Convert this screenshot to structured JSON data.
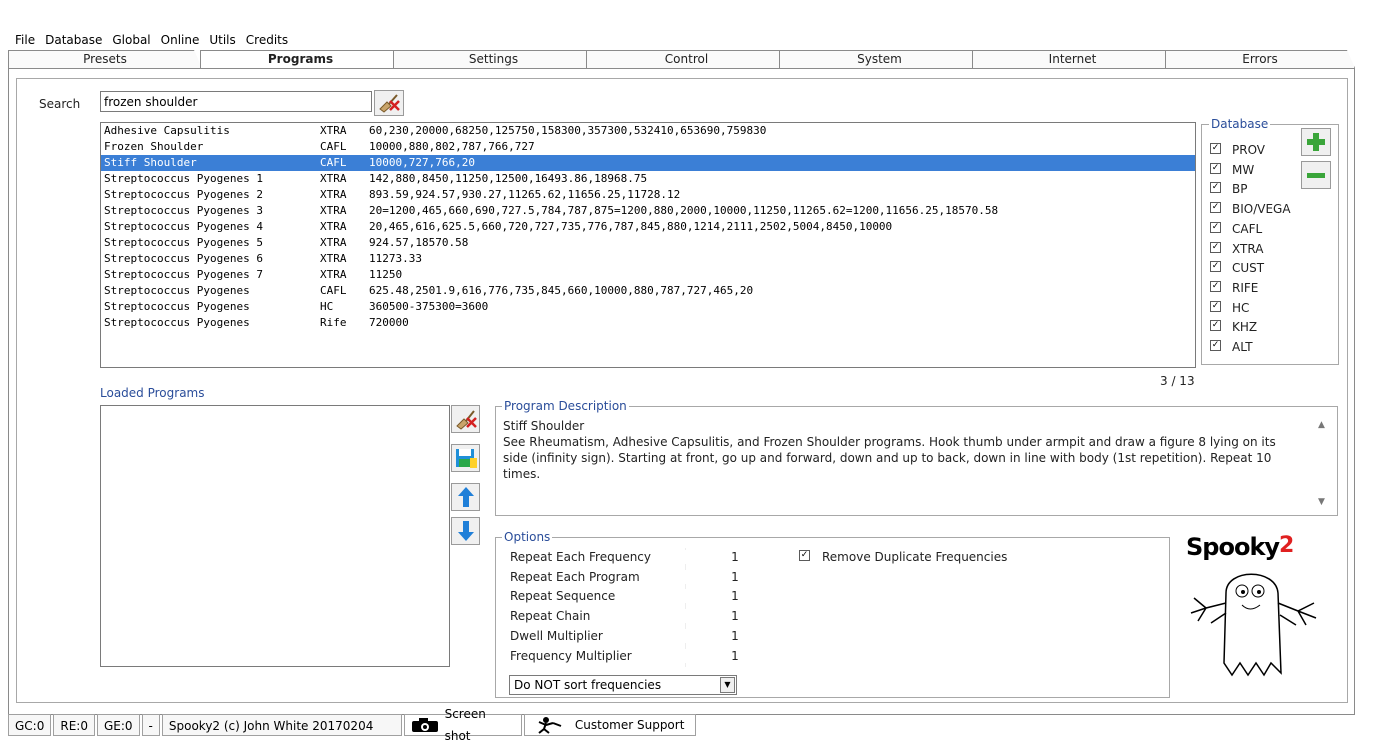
{
  "menu": [
    "File",
    "Database",
    "Global",
    "Online",
    "Utils",
    "Credits"
  ],
  "tabs": [
    "Presets",
    "Programs",
    "Settings",
    "Control",
    "System",
    "Internet",
    "Errors"
  ],
  "search": {
    "label": "Search",
    "value": "frozen shoulder"
  },
  "programs": [
    {
      "name": "Adhesive Capsulitis",
      "db": "XTRA",
      "freqs": "60,230,20000,68250,125750,158300,357300,532410,653690,759830"
    },
    {
      "name": "Frozen Shoulder",
      "db": "CAFL",
      "freqs": "10000,880,802,787,766,727"
    },
    {
      "name": "Stiff Shoulder",
      "db": "CAFL",
      "freqs": "10000,727,766,20"
    },
    {
      "name": "Streptococcus Pyogenes 1",
      "db": "XTRA",
      "freqs": "142,880,8450,11250,12500,16493.86,18968.75"
    },
    {
      "name": "Streptococcus Pyogenes 2",
      "db": "XTRA",
      "freqs": "893.59,924.57,930.27,11265.62,11656.25,11728.12"
    },
    {
      "name": "Streptococcus Pyogenes 3",
      "db": "XTRA",
      "freqs": "20=1200,465,660,690,727.5,784,787,875=1200,880,2000,10000,11250,11265.62=1200,11656.25,18570.58"
    },
    {
      "name": "Streptococcus Pyogenes 4",
      "db": "XTRA",
      "freqs": "20,465,616,625.5,660,720,727,735,776,787,845,880,1214,2111,2502,5004,8450,10000"
    },
    {
      "name": "Streptococcus Pyogenes 5",
      "db": "XTRA",
      "freqs": "924.57,18570.58"
    },
    {
      "name": "Streptococcus Pyogenes 6",
      "db": "XTRA",
      "freqs": "11273.33"
    },
    {
      "name": "Streptococcus Pyogenes 7",
      "db": "XTRA",
      "freqs": "11250"
    },
    {
      "name": "Streptococcus Pyogenes",
      "db": "CAFL",
      "freqs": "625.48,2501.9,616,776,735,845,660,10000,880,787,727,465,20"
    },
    {
      "name": "Streptococcus Pyogenes",
      "db": "HC",
      "freqs": "360500-375300=3600"
    },
    {
      "name": "Streptococcus Pyogenes",
      "db": "Rife",
      "freqs": "720000"
    }
  ],
  "selected_index": 2,
  "count_text": "3 / 13",
  "database": {
    "title": "Database",
    "items": [
      "PROV",
      "MW",
      "BP",
      "BIO/VEGA",
      "CAFL",
      "XTRA",
      "CUST",
      "RIFE",
      "HC",
      "KHZ",
      "ALT"
    ]
  },
  "loaded_programs_label": "Loaded Programs",
  "description": {
    "title": "Program Description",
    "name": "Stiff Shoulder",
    "text": "See Rheumatism, Adhesive Capsulitis, and Frozen Shoulder programs. Hook thumb under armpit and draw a figure 8 lying on its side (infinity sign). Starting at front, go up and forward, down and up to back, down in line with body (1st repetition). Repeat 10 times."
  },
  "options": {
    "title": "Options",
    "rows": [
      {
        "label": "Repeat Each Frequency",
        "value": "1"
      },
      {
        "label": "Repeat Each Program",
        "value": "1"
      },
      {
        "label": "Repeat Sequence",
        "value": "1"
      },
      {
        "label": "Repeat Chain",
        "value": "1"
      },
      {
        "label": "Dwell Multiplier",
        "value": "1"
      },
      {
        "label": "Frequency Multiplier",
        "value": "1"
      }
    ],
    "remove_duplicates": "Remove Duplicate Frequencies",
    "sort_value": "Do NOT sort frequencies"
  },
  "logo": {
    "text": "Spooky",
    "sup": "2"
  },
  "status": {
    "gc": "GC:0",
    "re": "RE:0",
    "ge": "GE:0",
    "dash": "-",
    "copyright": "Spooky2 (c) John White 20170204",
    "screenshot": "Screen shot",
    "support": "Customer Support"
  },
  "colors": {
    "selection": "#3b7fd6",
    "group_title": "#2a4d9a",
    "add": "#3aa53a",
    "remove": "#3aa53a",
    "arrow": "#1f7fd8"
  }
}
